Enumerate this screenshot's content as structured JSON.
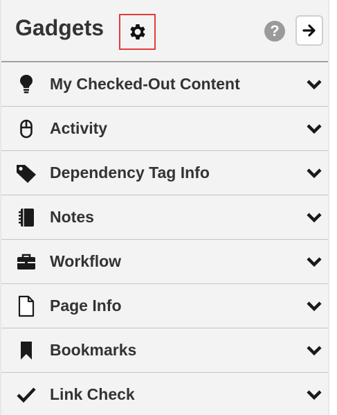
{
  "header": {
    "title": "Gadgets",
    "gear_icon": "gear-icon",
    "help_icon_glyph": "?",
    "collapse_icon": "arrow-right-icon"
  },
  "gadgets": [
    {
      "label": "My Checked-Out Content",
      "icon": "lightbulb-icon"
    },
    {
      "label": "Activity",
      "icon": "mouse-icon"
    },
    {
      "label": "Dependency Tag Info",
      "icon": "tag-icon"
    },
    {
      "label": "Notes",
      "icon": "notebook-icon"
    },
    {
      "label": "Workflow",
      "icon": "briefcase-icon"
    },
    {
      "label": "Page Info",
      "icon": "file-icon"
    },
    {
      "label": "Bookmarks",
      "icon": "bookmark-icon"
    },
    {
      "label": "Link Check",
      "icon": "checkmark-icon"
    }
  ],
  "colors": {
    "highlight_border": "#e23b3b",
    "row_background": "#f3f3f3",
    "text": "#333333"
  }
}
